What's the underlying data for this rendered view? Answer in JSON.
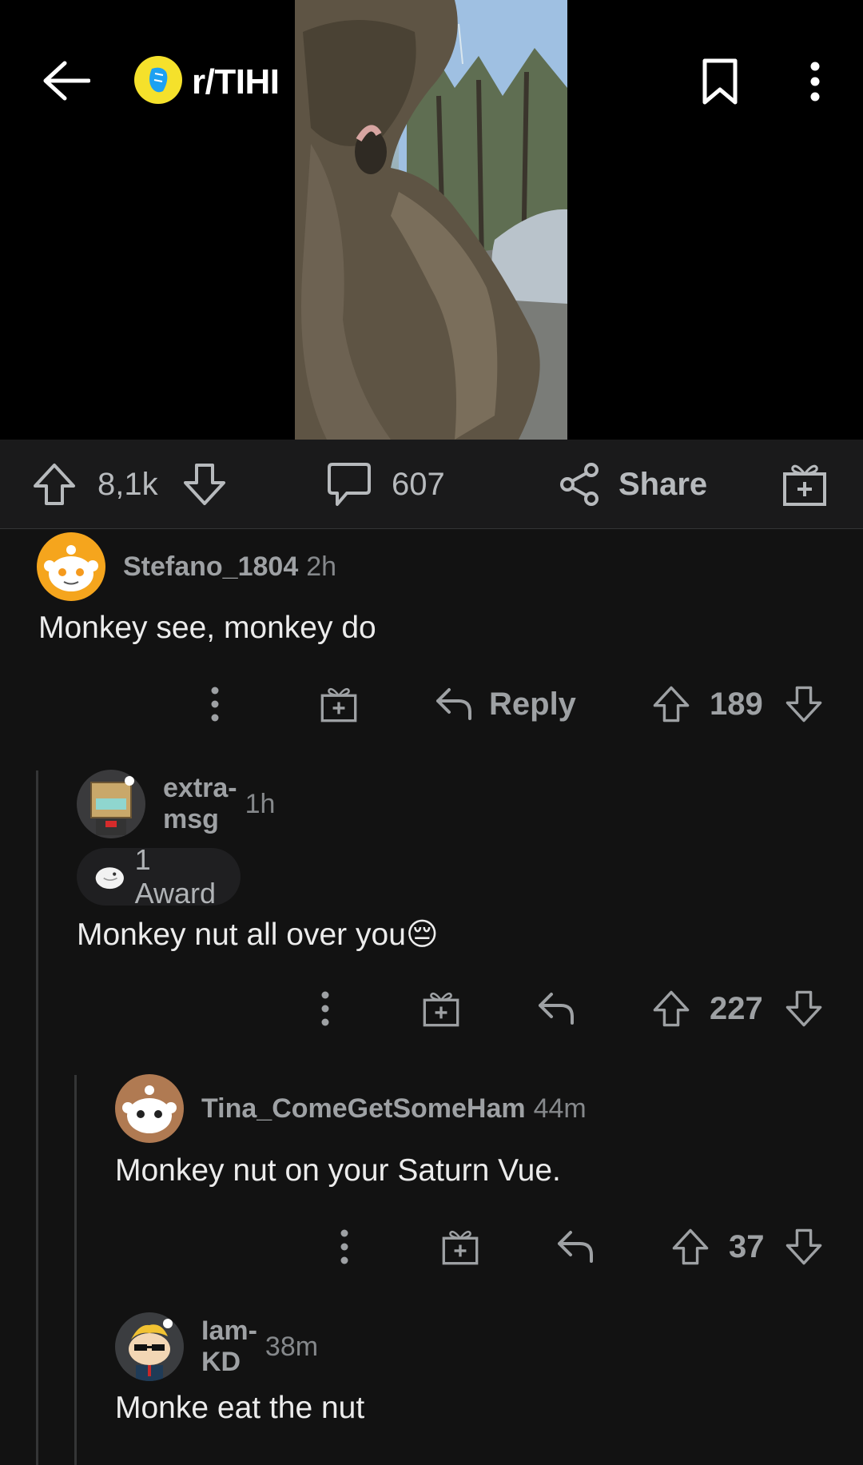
{
  "header": {
    "subreddit": "r/TIHI",
    "icons": {
      "back": "back-arrow-icon",
      "bookmark": "bookmark-icon",
      "more": "more-vertical-icon"
    }
  },
  "post_actions": {
    "score": "8,1k",
    "comments": "607",
    "share_label": "Share"
  },
  "comments": [
    {
      "username": "Stefano_1804",
      "time": "2h",
      "body": "Monkey see, monkey do",
      "reply_label": "Reply",
      "score": "189"
    },
    {
      "username": "extra-msg",
      "time": "1h",
      "award_label": "1 Award",
      "body": "Monkey nut all over you😔",
      "score": "227"
    },
    {
      "username": "Tina_ComeGetSomeHam",
      "time": "44m",
      "body": "Monkey nut on your Saturn Vue.",
      "score": "37"
    },
    {
      "username": "Iam-KD",
      "time": "38m",
      "body": "Monke eat the nut"
    }
  ],
  "colors": {
    "background": "#121212",
    "action_bar": "#1a1a1b",
    "text": "#ececec",
    "muted": "#9ea1a4",
    "subreddit_icon": "#f5e12b"
  }
}
